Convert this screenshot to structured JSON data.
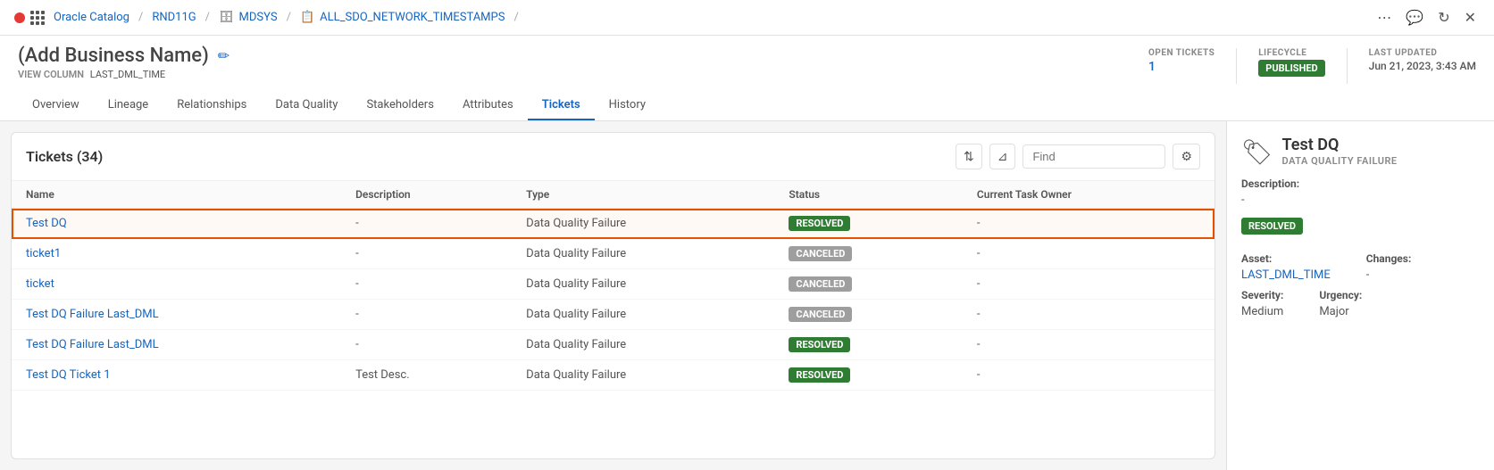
{
  "topnav": {
    "dot_color": "#e53935",
    "breadcrumbs": [
      {
        "label": "Oracle Catalog",
        "link": true
      },
      {
        "label": "RND11G",
        "link": true
      },
      {
        "label": "MDSYS",
        "link": true
      },
      {
        "label": "ALL_SDO_NETWORK_TIMESTAMPS",
        "link": true
      }
    ],
    "more_icon": "⋯",
    "chat_icon": "💬",
    "refresh_icon": "↻",
    "close_icon": "✕"
  },
  "header": {
    "title": "(Add Business Name)",
    "edit_icon": "✏",
    "view_column_label": "VIEW COLUMN",
    "view_column_value": "LAST_DML_TIME",
    "open_tickets_label": "OPEN TICKETS",
    "open_tickets_value": "1",
    "lifecycle_label": "LIFECYCLE",
    "lifecycle_badge": "PUBLISHED",
    "last_updated_label": "LAST UPDATED",
    "last_updated_value": "Jun 21, 2023, 3:43 AM"
  },
  "tabs": [
    {
      "id": "overview",
      "label": "Overview",
      "active": false
    },
    {
      "id": "lineage",
      "label": "Lineage",
      "active": false
    },
    {
      "id": "relationships",
      "label": "Relationships",
      "active": false
    },
    {
      "id": "data-quality",
      "label": "Data Quality",
      "active": false
    },
    {
      "id": "stakeholders",
      "label": "Stakeholders",
      "active": false
    },
    {
      "id": "attributes",
      "label": "Attributes",
      "active": false
    },
    {
      "id": "tickets",
      "label": "Tickets",
      "active": true
    },
    {
      "id": "history",
      "label": "History",
      "active": false
    }
  ],
  "tickets": {
    "title": "Tickets (34)",
    "find_placeholder": "Find",
    "columns": [
      "Name",
      "Description",
      "Type",
      "Status",
      "Current Task Owner"
    ],
    "rows": [
      {
        "name": "Test DQ",
        "description": "-",
        "type": "Data Quality Failure",
        "status": "RESOLVED",
        "owner": "-",
        "selected": true
      },
      {
        "name": "ticket1",
        "description": "-",
        "type": "Data Quality Failure",
        "status": "CANCELED",
        "owner": "-",
        "selected": false
      },
      {
        "name": "ticket",
        "description": "-",
        "type": "Data Quality Failure",
        "status": "CANCELED",
        "owner": "-",
        "selected": false
      },
      {
        "name": "Test DQ Failure Last_DML",
        "description": "-",
        "type": "Data Quality Failure",
        "status": "CANCELED",
        "owner": "-",
        "selected": false
      },
      {
        "name": "Test DQ Failure Last_DML",
        "description": "-",
        "type": "Data Quality Failure",
        "status": "RESOLVED",
        "owner": "-",
        "selected": false
      },
      {
        "name": "Test DQ Ticket 1",
        "description": "Test Desc.",
        "type": "Data Quality Failure",
        "status": "RESOLVED",
        "owner": "-",
        "selected": false
      }
    ]
  },
  "right_panel": {
    "icon": "🏷",
    "title": "Test DQ",
    "subtitle": "DATA QUALITY FAILURE",
    "description_label": "Description:",
    "description_value": "-",
    "status_badge": "RESOLVED",
    "asset_label": "Asset:",
    "asset_value": "LAST_DML_TIME",
    "changes_label": "Changes:",
    "changes_value": "-",
    "severity_label": "Severity:",
    "severity_value": "Medium",
    "urgency_label": "Urgency:",
    "urgency_value": "Major"
  }
}
